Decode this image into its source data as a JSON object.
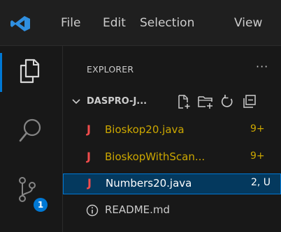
{
  "menu": {
    "items": [
      {
        "label": "File"
      },
      {
        "label": "Edit"
      },
      {
        "label": "Selection"
      },
      {
        "label": "View"
      }
    ]
  },
  "activity": {
    "scm_badge": "1"
  },
  "explorer": {
    "title": "EXPLORER",
    "more": "···",
    "folder": "DASPRO-J...",
    "files": [
      {
        "name": "Bioskop20.java",
        "status": "9+",
        "type": "java"
      },
      {
        "name": "BioskopWithScan...",
        "status": "9+",
        "type": "java"
      },
      {
        "name": "Numbers20.java",
        "status": "2, U",
        "type": "java"
      },
      {
        "name": "README.md",
        "status": "",
        "type": "info"
      }
    ]
  },
  "colors": {
    "accent": "#0078d4",
    "warning": "#cca700",
    "java_icon": "#f14c4c",
    "selected_bg": "#04395e"
  }
}
